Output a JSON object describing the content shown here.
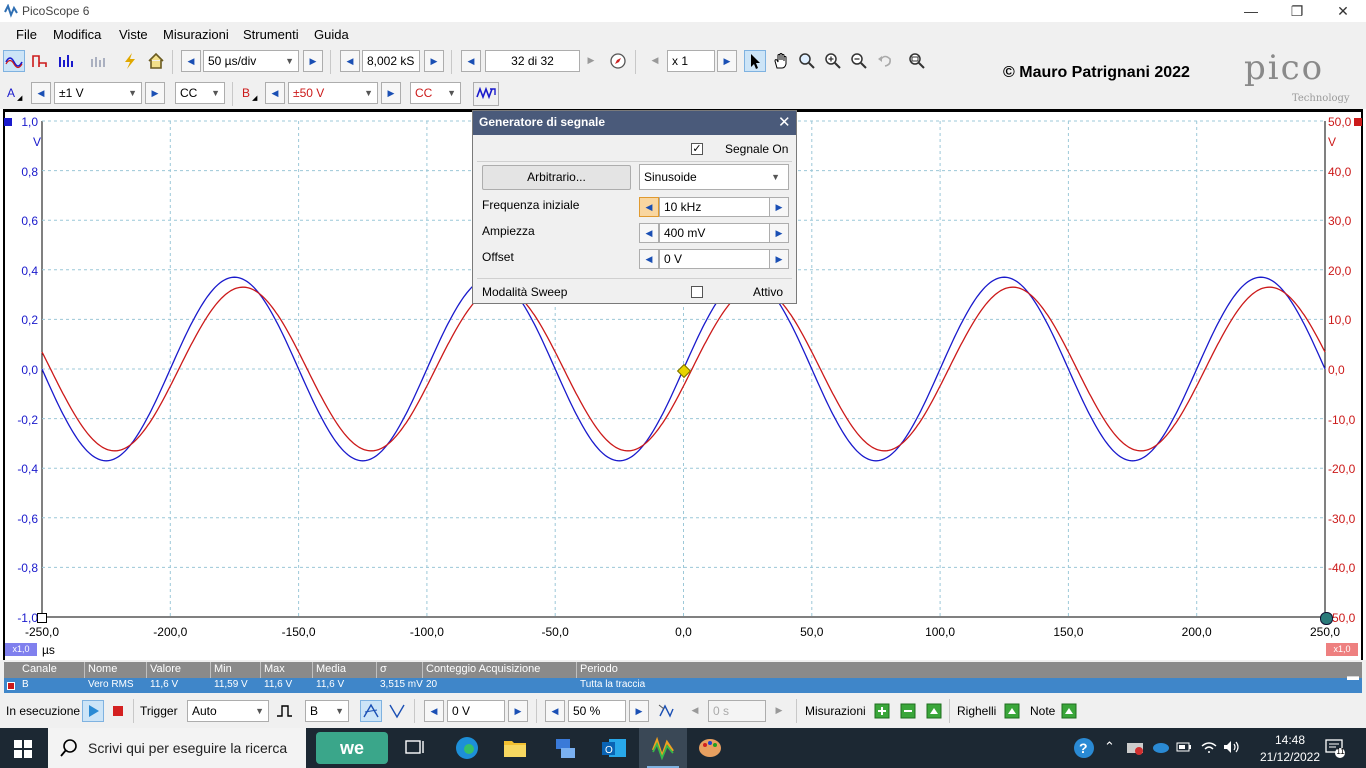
{
  "window": {
    "title": "PicoScope 6",
    "controls": [
      "—",
      "❐",
      "✕"
    ]
  },
  "menu": [
    "File",
    "Modifica",
    "Viste",
    "Misurazioni",
    "Strumenti",
    "Guida"
  ],
  "toolbar": {
    "timebase": "50 µs/div",
    "samples": "8,002 kS",
    "buffer": "32 di 32",
    "zoom": "x 1",
    "copyright": "© Mauro Patrignani 2022",
    "logo_text": "pico",
    "logo_sub": "Technology"
  },
  "channels": {
    "a": {
      "label": "A",
      "range": "±1 V",
      "coupling": "CC",
      "color": "#1a1acc"
    },
    "b": {
      "label": "B",
      "range": "±50 V",
      "coupling": "CC",
      "color": "#cc1a1a"
    }
  },
  "axis": {
    "left_ticks": [
      "1,0",
      "0,8",
      "0,6",
      "0,4",
      "0,2",
      "0,0",
      "-0,2",
      "-0,4",
      "-0,6",
      "-0,8",
      "-1,0"
    ],
    "left_unit": "V",
    "right_ticks": [
      "50,0",
      "40,0",
      "30,0",
      "20,0",
      "10,0",
      "0,0",
      "-10,0",
      "-20,0",
      "-30,0",
      "-40,0",
      "-50,0"
    ],
    "right_unit": "V",
    "x_ticks": [
      "-250,0",
      "-200,0",
      "-150,0",
      "-100,0",
      "-50,0",
      "0,0",
      "50,0",
      "100,0",
      "150,0",
      "200,0",
      "250,0"
    ],
    "x_unit": "µs",
    "x1_left": "x1,0",
    "x1_right": "x1,0"
  },
  "chart_data": {
    "type": "line",
    "x_range": [
      -250,
      250
    ],
    "grid": true,
    "series": [
      {
        "channel": "A",
        "color": "#1a1acc",
        "unit": "V",
        "amplitude": 0.37,
        "frequency_khz": 10,
        "phase_deg": 0
      },
      {
        "channel": "B",
        "color": "#cc1a1a",
        "unit": "V",
        "amplitude": 16.5,
        "frequency_khz": 10,
        "phase_deg": -12
      }
    ],
    "y_left_range": [
      -1,
      1
    ],
    "y_right_range": [
      -50,
      50
    ]
  },
  "measurements": {
    "headers": [
      "Canale",
      "Nome",
      "Valore",
      "Min",
      "Max",
      "Media",
      "σ",
      "Conteggio Acquisizione",
      "Periodo"
    ],
    "rows": [
      [
        "B",
        "Vero RMS",
        "11,6 V",
        "11,59 V",
        "11,6 V",
        "11,6 V",
        "3,515 mV",
        "20",
        "Tutta la traccia"
      ]
    ]
  },
  "bottom": {
    "running": "In esecuzione",
    "trigger_label": "Trigger",
    "trigger_mode": "Auto",
    "trigger_channel": "B",
    "trigger_level": "0 V",
    "pretrigger": "50 %",
    "delay": "0 s",
    "measurements_label": "Misurazioni",
    "rulers_label": "Righelli",
    "notes_label": "Note"
  },
  "dialog": {
    "title": "Generatore di segnale",
    "signal_on": "Segnale On",
    "arbitrary_button": "Arbitrario...",
    "waveform": "Sinusoide",
    "freq_label": "Frequenza iniziale",
    "freq_value": "10 kHz",
    "amp_label": "Ampiezza",
    "amp_value": "400 mV",
    "offset_label": "Offset",
    "offset_value": "0 V",
    "sweep_label": "Modalità Sweep",
    "active_label": "Attivo"
  },
  "taskbar": {
    "search_placeholder": "Scrivi qui per eseguire la ricerca",
    "time": "14:48",
    "date": "21/12/2022",
    "notifications": "11"
  }
}
